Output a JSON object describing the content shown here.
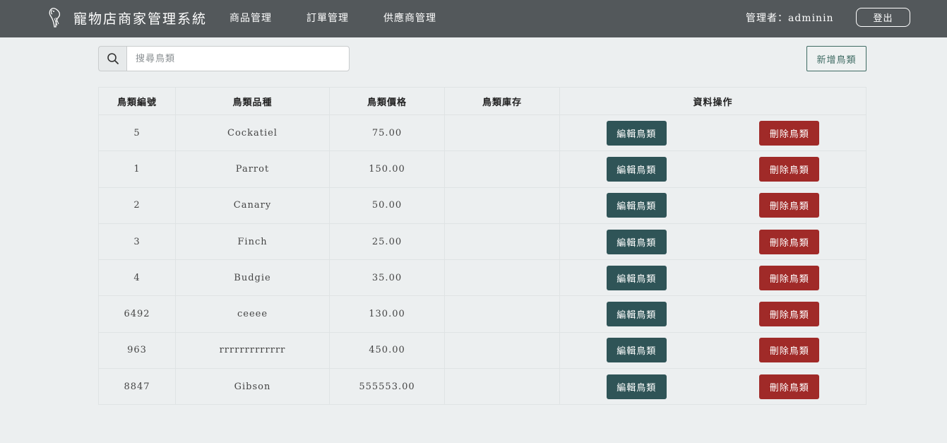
{
  "header": {
    "title": "寵物店商家管理系統",
    "nav": [
      "商品管理",
      "訂單管理",
      "供應商管理"
    ],
    "admin_label": "管理者：adminin",
    "logout_label": "登出"
  },
  "search": {
    "placeholder": "搜尋鳥類",
    "value": ""
  },
  "toolbar": {
    "add_label": "新增鳥類"
  },
  "table": {
    "headers": [
      "鳥類編號",
      "鳥類品種",
      "鳥類價格",
      "鳥類庫存",
      "資料操作"
    ],
    "edit_label": "編輯鳥類",
    "delete_label": "刪除鳥類",
    "rows": [
      {
        "id": "5",
        "name": "Cockatiel",
        "price": "75.00",
        "stock": ""
      },
      {
        "id": "1",
        "name": "Parrot",
        "price": "150.00",
        "stock": ""
      },
      {
        "id": "2",
        "name": "Canary",
        "price": "50.00",
        "stock": ""
      },
      {
        "id": "3",
        "name": "Finch",
        "price": "25.00",
        "stock": ""
      },
      {
        "id": "4",
        "name": "Budgie",
        "price": "35.00",
        "stock": ""
      },
      {
        "id": "6492",
        "name": "ceeee",
        "price": "130.00",
        "stock": ""
      },
      {
        "id": "963",
        "name": "rrrrrrrrrrrrr",
        "price": "450.00",
        "stock": ""
      },
      {
        "id": "8847",
        "name": "Gibson",
        "price": "555553.00",
        "stock": ""
      }
    ]
  },
  "colors": {
    "navbar": "#53585b",
    "edit_button": "#2f5457",
    "delete_button": "#a02a28",
    "add_button_accent": "#3f6b63"
  },
  "icons": {
    "logo": "parrot-logo-icon",
    "search": "search-icon"
  }
}
